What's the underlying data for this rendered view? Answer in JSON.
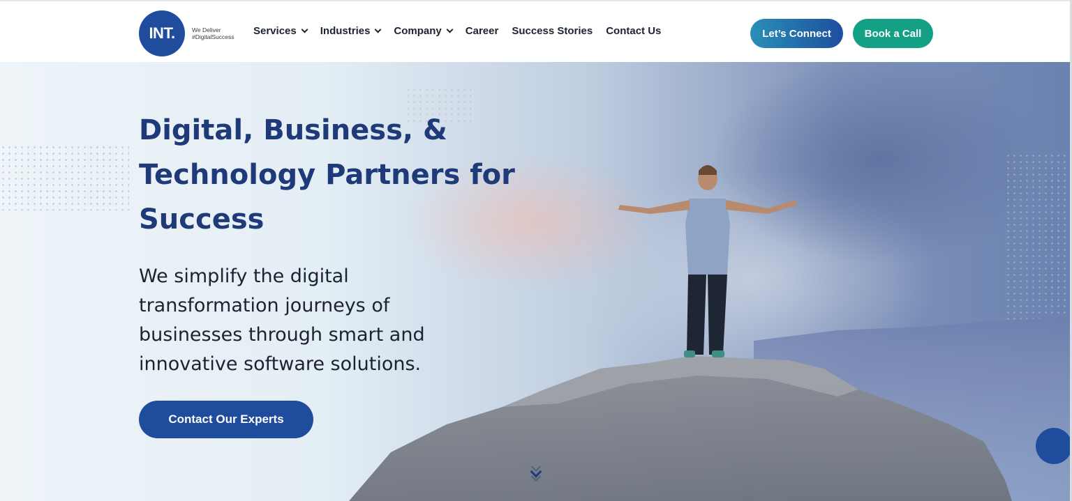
{
  "header": {
    "logo_text": "INT.",
    "tagline_line1": "We Deliver",
    "tagline_line2": "#DigitalSuccess",
    "nav": [
      {
        "label": "Services",
        "has_dropdown": true
      },
      {
        "label": "Industries",
        "has_dropdown": true
      },
      {
        "label": "Company",
        "has_dropdown": true
      },
      {
        "label": "Career",
        "has_dropdown": false
      },
      {
        "label": "Success Stories",
        "has_dropdown": false
      },
      {
        "label": "Contact Us",
        "has_dropdown": false
      }
    ],
    "connect_label": "Let’s Connect",
    "book_label": "Book a Call"
  },
  "hero": {
    "headline_line1": "Digital, Business, &",
    "headline_line2": "Technology Partners for",
    "headline_line3": "Success",
    "sub_line1": "We simplify the digital",
    "sub_line2": "transformation journeys of",
    "sub_line3": "businesses through smart and",
    "sub_line4": "innovative software solutions.",
    "cta_label": "Contact Our Experts"
  },
  "colors": {
    "brand_blue": "#1f4c9c",
    "heading_blue": "#1f3a78",
    "book_green": "#13a085",
    "connect_gradient_start": "#2a8fb6"
  },
  "icons": {
    "dropdown": "chevron-down-icon",
    "scroll": "scroll-down-chevrons-icon",
    "chat": "chat-widget-icon"
  }
}
